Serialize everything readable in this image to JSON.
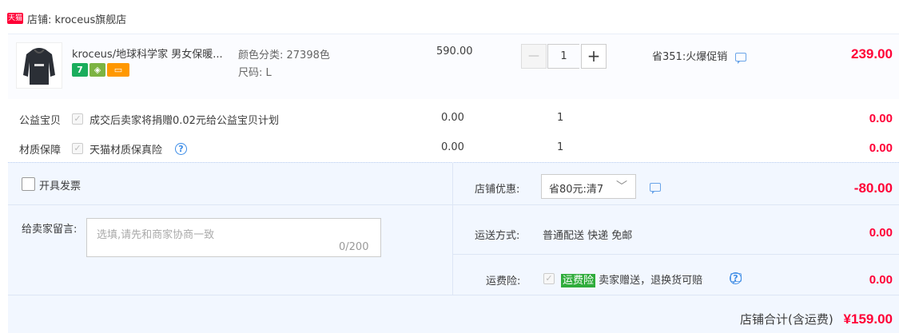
{
  "shop": {
    "logo_text": "天猫",
    "name": "店铺: kroceus旗舰店"
  },
  "product": {
    "title": "kroceus/地球科学家 男女保暖...",
    "sku_color": "颜色分类: 27398色",
    "sku_size": "尺码: L",
    "unit_price": "590.00",
    "quantity": "1",
    "minus": "—",
    "plus": "+",
    "promo": "省351:火爆促销",
    "total": "239.00",
    "badges": [
      {
        "icon": "seven-day-return-icon",
        "text": "7",
        "color": "#1aad5c"
      },
      {
        "icon": "consumer-guarantee-icon",
        "text": "◈",
        "color": "#7cb342"
      },
      {
        "icon": "credit-card-icon",
        "text": "▭",
        "color": "#ff9800"
      }
    ]
  },
  "services": [
    {
      "label": "公益宝贝",
      "desc": "成交后卖家将捐赠0.02元给公益宝贝计划",
      "price": "0.00",
      "qty": "1",
      "total": "0.00"
    },
    {
      "label": "材质保障",
      "desc": "天猫材质保真险",
      "price": "0.00",
      "qty": "1",
      "total": "0.00"
    }
  ],
  "invoice_label": "开具发票",
  "message": {
    "label": "给卖家留言:",
    "placeholder": "选填,请先和商家协商一致",
    "count": "0/200"
  },
  "discount": {
    "label": "店铺优惠:",
    "value": "省80元:清7",
    "amount": "-80.00"
  },
  "shipping": {
    "label": "运送方式:",
    "value": "普通配送 快递 免邮",
    "amount": "0.00"
  },
  "insurance": {
    "label": "运费险:",
    "tag": "运费险",
    "desc": " 卖家赠送，退换货可赔",
    "amount": "0.00"
  },
  "summary": {
    "label": "店铺合计(含运费)",
    "total": "¥159.00"
  },
  "colors": {
    "accent_red": "#ff0036",
    "panel_bg": "#f2f7ff",
    "green": "#2fac3b"
  }
}
